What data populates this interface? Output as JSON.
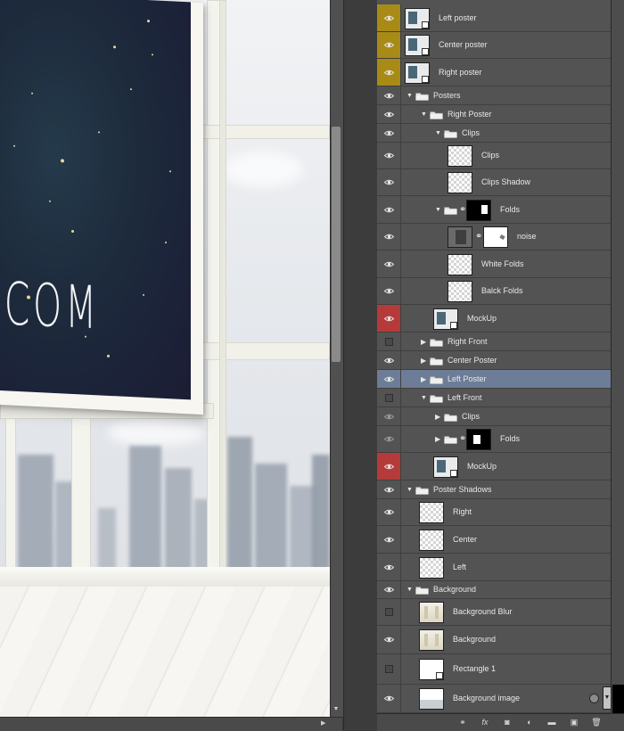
{
  "canvas": {
    "poster_text": ".COM"
  },
  "layers": [
    {
      "name": "Left poster",
      "visible": true,
      "eye_color": "yellow",
      "indent": 0,
      "kind": "smart",
      "thumb": "poster",
      "fx": false
    },
    {
      "name": "Center poster",
      "visible": true,
      "eye_color": "yellow",
      "indent": 0,
      "kind": "smart",
      "thumb": "poster",
      "fx": false
    },
    {
      "name": "Right poster",
      "visible": true,
      "eye_color": "yellow",
      "indent": 0,
      "kind": "smart",
      "thumb": "poster",
      "fx": false
    },
    {
      "name": "Posters",
      "visible": true,
      "indent": 0,
      "kind": "group",
      "expanded": true
    },
    {
      "name": "Right Poster",
      "visible": true,
      "indent": 1,
      "kind": "group",
      "expanded": true
    },
    {
      "name": "Clips",
      "visible": true,
      "indent": 2,
      "kind": "group",
      "expanded": true
    },
    {
      "name": "Clips",
      "visible": true,
      "indent": 3,
      "kind": "layer",
      "thumb": "transparent"
    },
    {
      "name": "Clips Shadow",
      "visible": true,
      "indent": 3,
      "kind": "layer",
      "thumb": "transparent"
    },
    {
      "name": "Folds",
      "visible": true,
      "indent": 2,
      "kind": "group-mask",
      "expanded": true,
      "mask": "folds"
    },
    {
      "name": "noise",
      "visible": true,
      "indent": 3,
      "kind": "layer-mask",
      "thumb": "noise",
      "mask": "noise"
    },
    {
      "name": "White Folds",
      "visible": true,
      "indent": 3,
      "kind": "layer",
      "thumb": "transparent"
    },
    {
      "name": "Balck Folds",
      "visible": true,
      "indent": 3,
      "kind": "layer",
      "thumb": "transparent"
    },
    {
      "name": "MockUp",
      "visible": true,
      "eye_color": "red",
      "indent": 2,
      "kind": "smart",
      "thumb": "poster"
    },
    {
      "name": "Right Front",
      "visible": false,
      "indent": 1,
      "kind": "group",
      "expanded": false
    },
    {
      "name": "Center Poster",
      "visible": true,
      "indent": 1,
      "kind": "group",
      "expanded": false
    },
    {
      "name": "Left Poster",
      "visible": true,
      "indent": 1,
      "kind": "group",
      "expanded": false,
      "selected": true
    },
    {
      "name": "Left Front",
      "visible": false,
      "indent": 1,
      "kind": "group",
      "expanded": true
    },
    {
      "name": "Clips",
      "visible": true,
      "dim": true,
      "indent": 2,
      "kind": "group",
      "expanded": false
    },
    {
      "name": "Folds",
      "visible": true,
      "dim": true,
      "indent": 2,
      "kind": "group-mask",
      "expanded": false,
      "mask": "folds2"
    },
    {
      "name": "MockUp",
      "visible": true,
      "eye_color": "red",
      "indent": 2,
      "kind": "smart",
      "thumb": "poster"
    },
    {
      "name": "Poster Shadows",
      "visible": true,
      "indent": 0,
      "kind": "group",
      "expanded": true
    },
    {
      "name": "Right",
      "visible": true,
      "indent": 1,
      "kind": "layer",
      "thumb": "transparent"
    },
    {
      "name": "Center",
      "visible": true,
      "indent": 1,
      "kind": "layer",
      "thumb": "transparent"
    },
    {
      "name": "Left",
      "visible": true,
      "indent": 1,
      "kind": "layer",
      "thumb": "transparent"
    },
    {
      "name": "Background",
      "visible": true,
      "indent": 0,
      "kind": "group",
      "expanded": true
    },
    {
      "name": "Background Blur",
      "visible": false,
      "indent": 1,
      "kind": "layer",
      "thumb": "bg"
    },
    {
      "name": "Background",
      "visible": true,
      "indent": 1,
      "kind": "layer",
      "thumb": "bg"
    },
    {
      "name": "Rectangle 1",
      "visible": false,
      "indent": 1,
      "kind": "smart",
      "thumb": "white"
    },
    {
      "name": "Background image",
      "visible": true,
      "indent": 1,
      "kind": "layer",
      "thumb": "img",
      "fx": true
    }
  ],
  "footer_icons": [
    "link-icon",
    "fx-icon",
    "add-mask-icon",
    "adjustment-icon",
    "new-group-icon",
    "new-layer-icon",
    "trash-icon"
  ],
  "footer_glyphs": {
    "link": "⚭",
    "fx": "fx",
    "mask": "◙",
    "adjust": "◐",
    "group": "▬",
    "new": "▣",
    "trash": "🗑"
  }
}
